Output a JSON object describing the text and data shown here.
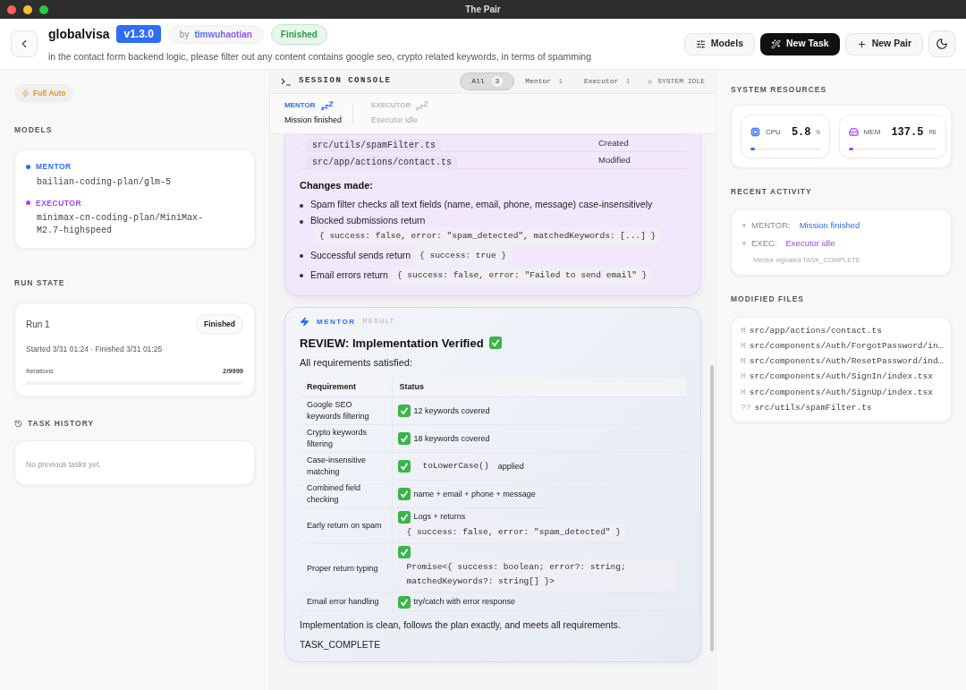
{
  "window": {
    "title": "The Pair"
  },
  "header": {
    "project": "globalvisa",
    "version": "v1.3.0",
    "by": "by",
    "author": "timwuhaotian",
    "status": "Finished",
    "task": "in the contact form backend logic, please filter out any content contains google seo, crypto related keywords, in terms of spamming",
    "buttons": [
      {
        "label": "Models",
        "kind": "sliders",
        "primary": false
      },
      {
        "label": "New Task",
        "kind": "wand",
        "primary": true
      },
      {
        "label": "New Pair",
        "kind": "plus",
        "primary": false
      },
      {
        "kind": "moon",
        "primary": false
      }
    ]
  },
  "sidebar": {
    "mode": "Full Auto",
    "models_title": "MODELS",
    "models": [
      {
        "role": "MENTOR",
        "color": "#2f6df6",
        "model": "bailian-coding-plan/glm-5"
      },
      {
        "role": "EXECUTOR",
        "color": "#a244f0",
        "model": "minimax-cn-coding-plan/MiniMax-M2.7-highspeed"
      }
    ],
    "run_state_title": "RUN STATE",
    "run": {
      "name": "Run 1",
      "status": "Finished",
      "times": "Started 3/31 01:24 · Finished 3/31 01:25",
      "iterations_label": "Iterations",
      "iterations": "2/9999",
      "level": 0.0002
    },
    "history_title": "TASK HISTORY",
    "history_empty": "No previous tasks yet."
  },
  "console": {
    "title": "SESSION CONSOLE",
    "tabs": [
      {
        "label": "All",
        "count": "3",
        "selected": true
      },
      {
        "label": "Mentor",
        "count": "1",
        "selected": false
      },
      {
        "label": "Executor",
        "count": "1",
        "selected": false
      }
    ],
    "system_status": "SYSTEM IDLE",
    "agents": [
      {
        "role": "MENTOR",
        "state": "Mission finished",
        "active": true
      },
      {
        "role": "EXECUTOR",
        "state": "Executor idle",
        "active": false
      }
    ],
    "executor_card": {
      "files": [
        {
          "path": "src/utils/spamFilter.ts",
          "change": "Created"
        },
        {
          "path": "src/app/actions/contact.ts",
          "change": "Modified"
        }
      ],
      "changes_title": "Changes made:",
      "bullets": [
        [
          {
            "kind": "text",
            "text": "Spam filter checks all text fields (name, email, phone, message) case-insensitively"
          }
        ],
        [
          {
            "kind": "text",
            "text": "Blocked submissions return"
          },
          {
            "kind": "code",
            "text": "{ success: false, error: \"spam_detected\", matchedKeywords: [...] }"
          }
        ],
        [
          {
            "kind": "text",
            "text": "Successful sends return"
          },
          {
            "kind": "code",
            "text": "{ success: true }"
          }
        ],
        [
          {
            "kind": "text",
            "text": "Email errors return"
          },
          {
            "kind": "code",
            "text": "{ success: false, error: \"Failed to send email\" }"
          }
        ]
      ]
    },
    "mentor_card": {
      "role": "MENTOR",
      "tag": "RESULT",
      "heading": "REVIEW: Implementation Verified",
      "intro": "All requirements satisfied:",
      "columns": [
        "Requirement",
        "Status"
      ],
      "rows": [
        {
          "requirement": "Google SEO keywords filtering",
          "status": [
            {
              "kind": "text",
              "text": "12 keywords covered"
            }
          ]
        },
        {
          "requirement": "Crypto keywords filtering",
          "status": [
            {
              "kind": "text",
              "text": "18 keywords covered"
            }
          ]
        },
        {
          "requirement": "Case-insensitive matching",
          "status": [
            {
              "kind": "code",
              "text": "toLowerCase()"
            },
            {
              "kind": "text",
              "text": "applied"
            }
          ]
        },
        {
          "requirement": "Combined field checking",
          "status": [
            {
              "kind": "text",
              "text": "name + email + phone + message"
            }
          ]
        },
        {
          "requirement": "Early return on spam",
          "status": [
            {
              "kind": "text",
              "text": "Logs + returns"
            },
            {
              "kind": "code",
              "text": "{ success: false, error: \"spam_detected\" }"
            }
          ]
        },
        {
          "requirement": "Proper return typing",
          "status": [
            {
              "kind": "code",
              "text": "Promise<{ success: boolean; error?: string; matchedKeywords?: string[] }>"
            }
          ]
        },
        {
          "requirement": "Email error handling",
          "status": [
            {
              "kind": "text",
              "text": "try/catch with error response"
            }
          ]
        }
      ],
      "summary": "Implementation is clean, follows the plan exactly, and meets all requirements.",
      "signal": "TASK_COMPLETE"
    }
  },
  "right": {
    "resources_title": "SYSTEM RESOURCES",
    "resources": [
      {
        "label": "CPU",
        "value": "5.8",
        "unit": "%",
        "level": 0.06,
        "color": "#2f6df6"
      },
      {
        "label": "MEM",
        "value": "137.5",
        "unit": "MB",
        "level": 0.02,
        "color": "#a244f0"
      }
    ],
    "activity_title": "RECENT ACTIVITY",
    "activity": [
      {
        "who": "MENTOR:",
        "what": "Mission finished",
        "kind": "mentor"
      },
      {
        "who": "EXEC:",
        "what": "Executor idle",
        "kind": "executor"
      }
    ],
    "activity_note": "Mentor signaled TASK_COMPLETE",
    "files_title": "MODIFIED FILES",
    "files": [
      {
        "status": "M",
        "path": "src/app/actions/contact.ts"
      },
      {
        "status": "M",
        "path": "src/components/Auth/ForgotPassword/in…"
      },
      {
        "status": "M",
        "path": "src/components/Auth/ResetPassword/ind…"
      },
      {
        "status": "M",
        "path": "src/components/Auth/SignIn/index.tsx"
      },
      {
        "status": "M",
        "path": "src/components/Auth/SignUp/index.tsx"
      },
      {
        "status": "??",
        "path": "src/utils/spamFilter.ts"
      }
    ]
  }
}
